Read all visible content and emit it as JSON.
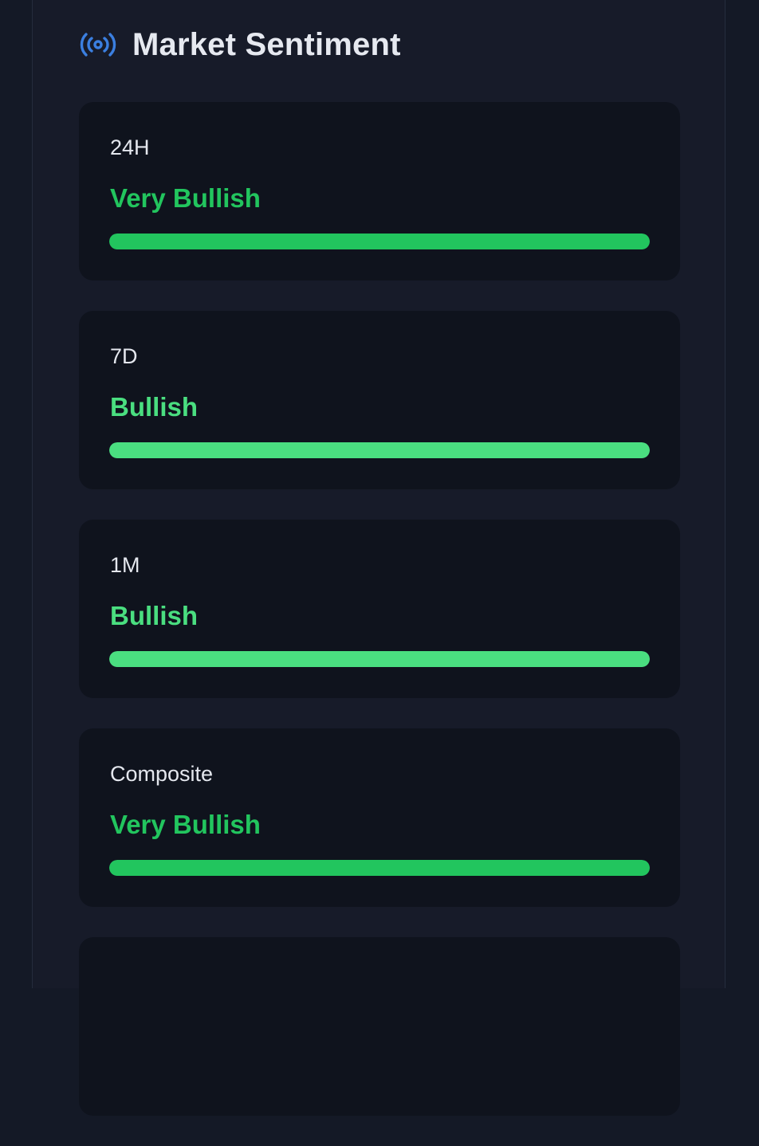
{
  "header": {
    "title": "Market Sentiment",
    "icon": "broadcast-icon",
    "icon_color": "#3b7fe0"
  },
  "cards": [
    {
      "label": "24H",
      "sentiment": "Very Bullish",
      "color": "#22c55e",
      "level": 1.0
    },
    {
      "label": "7D",
      "sentiment": "Bullish",
      "color": "#4ade80",
      "level": 1.0
    },
    {
      "label": "1M",
      "sentiment": "Bullish",
      "color": "#4ade80",
      "level": 1.0
    },
    {
      "label": "Composite",
      "sentiment": "Very Bullish",
      "color": "#22c55e",
      "level": 1.0
    }
  ]
}
